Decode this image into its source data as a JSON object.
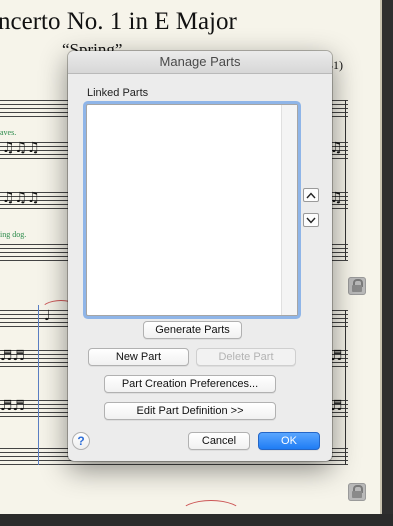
{
  "score": {
    "title": "ncerto No. 1 in E Major",
    "subtitle": "“Spring”",
    "opus": "41)",
    "annotation_1": "aves.",
    "annotation_2": "ing dog."
  },
  "dialog": {
    "title": "Manage Parts",
    "linked_parts_label": "Linked Parts",
    "linked_parts_items": [],
    "generate_parts_label": "Generate Parts",
    "new_part_label": "New Part",
    "delete_part_label": "Delete Part",
    "part_creation_prefs_label": "Part Creation Preferences...",
    "edit_part_definition_label": "Edit Part Definition >>",
    "cancel_label": "Cancel",
    "ok_label": "OK",
    "help_label": "?"
  },
  "colors": {
    "primary_button": "#1f7cf4",
    "list_focus_ring": "#8fb5e8",
    "paper": "#f6f4ea"
  }
}
